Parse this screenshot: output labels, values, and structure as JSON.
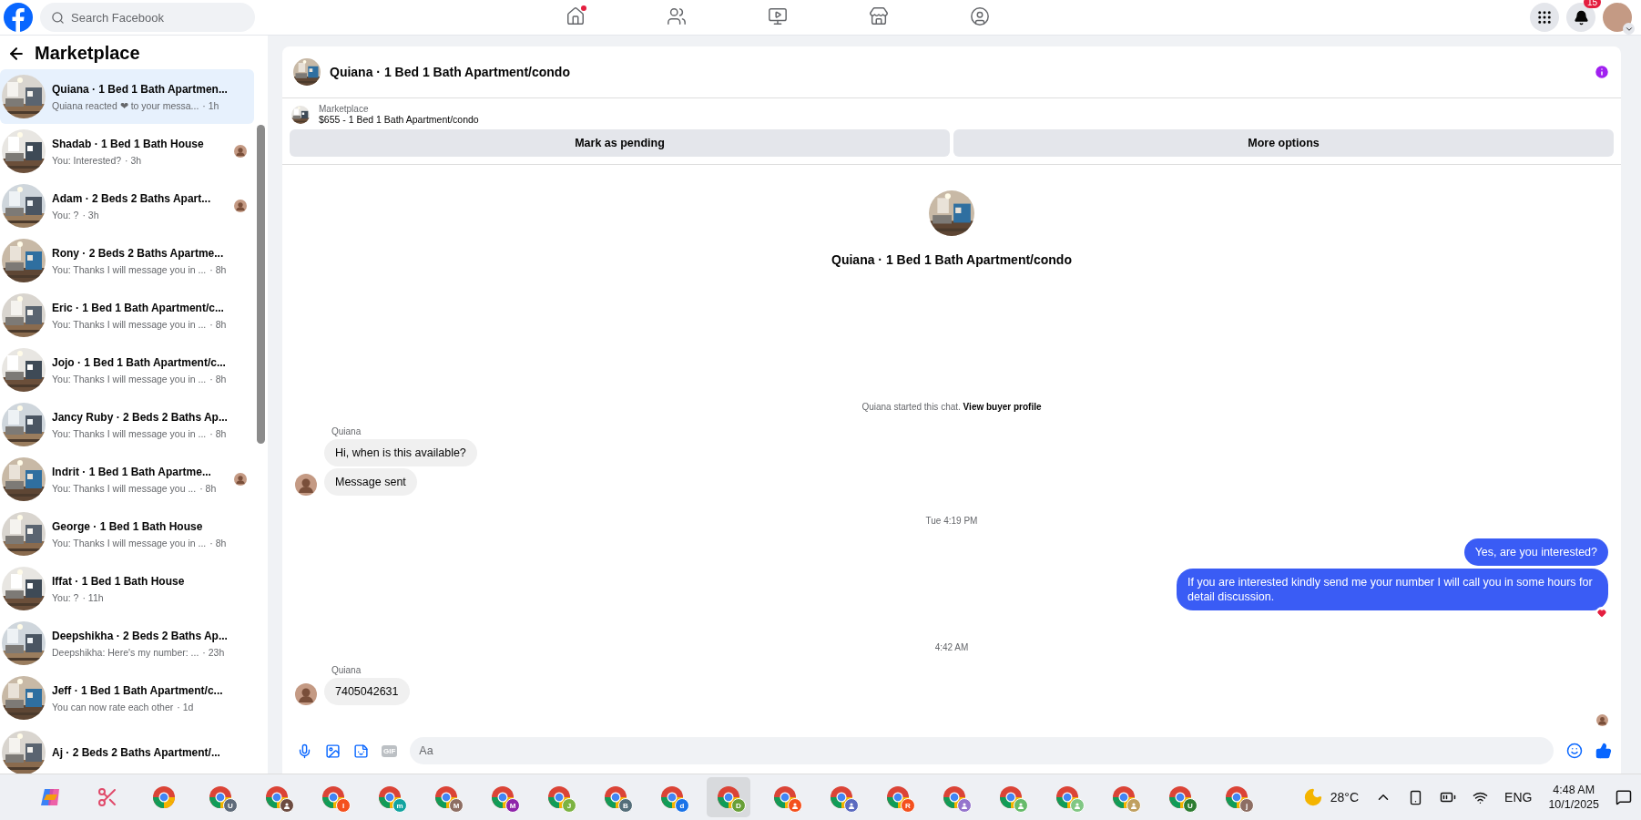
{
  "topbar": {
    "search": {
      "placeholder": "Search Facebook"
    },
    "nav": [
      {
        "kind": "home",
        "selected": false,
        "dot": true
      },
      {
        "kind": "friends",
        "selected": false,
        "dot": false
      },
      {
        "kind": "video",
        "selected": false,
        "dot": false
      },
      {
        "kind": "marketplace",
        "selected": false,
        "dot": false
      },
      {
        "kind": "groups",
        "selected": false,
        "dot": false
      }
    ],
    "notifications_badge": "15"
  },
  "sidebar": {
    "title": "Marketplace",
    "conversations": [
      {
        "title": "Quiana · 1 Bed 1 Bath Apartmen...",
        "preview": "Quiana reacted ❤ to your messa...",
        "time": "· 1h",
        "selected": true,
        "seen": false
      },
      {
        "title": "Shadab · 1 Bed 1 Bath House",
        "preview": "You: Interested?",
        "time": "· 3h",
        "selected": false,
        "seen": true
      },
      {
        "title": "Adam · 2 Beds 2 Baths Apart...",
        "preview": "You: ?",
        "time": "· 3h",
        "selected": false,
        "seen": true
      },
      {
        "title": "Rony · 2 Beds 2 Baths Apartme...",
        "preview": "You: Thanks I will message you in ...",
        "time": "· 8h",
        "selected": false,
        "seen": false
      },
      {
        "title": "Eric · 1 Bed 1 Bath Apartment/c...",
        "preview": "You: Thanks I will message you in ...",
        "time": "· 8h",
        "selected": false,
        "seen": false
      },
      {
        "title": "Jojo · 1 Bed 1 Bath Apartment/c...",
        "preview": "You: Thanks I will message you in ...",
        "time": "· 8h",
        "selected": false,
        "seen": false
      },
      {
        "title": "Jancy Ruby · 2 Beds 2 Baths Ap...",
        "preview": "You: Thanks I will message you in ...",
        "time": "· 8h",
        "selected": false,
        "seen": false
      },
      {
        "title": "Indrit · 1 Bed 1 Bath Apartme...",
        "preview": "You: Thanks I will message you ...",
        "time": "· 8h",
        "selected": false,
        "seen": true
      },
      {
        "title": "George · 1 Bed 1 Bath House",
        "preview": "You: Thanks I will message you in ...",
        "time": "· 8h",
        "selected": false,
        "seen": false
      },
      {
        "title": "Iffat · 1 Bed 1 Bath House",
        "preview": "You: ?",
        "time": "· 11h",
        "selected": false,
        "seen": false
      },
      {
        "title": "Deepshikha · 2 Beds 2 Baths Ap...",
        "preview": "Deepshikha: Here's my number: ...",
        "time": "· 23h",
        "selected": false,
        "seen": false
      },
      {
        "title": "Jeff · 1 Bed 1 Bath Apartment/c...",
        "preview": "You can now rate each other",
        "time": "· 1d",
        "selected": false,
        "seen": false
      },
      {
        "title": "Aj · 2 Beds 2 Baths Apartment/...",
        "selected": false,
        "seen": false
      }
    ]
  },
  "chat": {
    "title": "Quiana · 1 Bed 1 Bath Apartment/condo",
    "listing": {
      "label": "Marketplace",
      "text": "$655 - 1 Bed 1 Bath Apartment/condo"
    },
    "buttons": [
      "Mark as pending",
      "More options"
    ],
    "intro_title": "Quiana · 1 Bed 1 Bath Apartment/condo",
    "messages": [
      {
        "kind": "system",
        "text": "Quiana started this chat.",
        "link": "View buyer profile"
      },
      {
        "kind": "sender",
        "text": "Quiana"
      },
      {
        "kind": "incoming",
        "text": "Hi, when is this available?",
        "avatar": false
      },
      {
        "kind": "incoming",
        "text": "Message sent",
        "avatar": true
      },
      {
        "kind": "timestamp",
        "text": "Tue 4:19 PM"
      },
      {
        "kind": "outgoing",
        "text": "Yes, are you interested?",
        "reacted": false
      },
      {
        "kind": "outgoing",
        "text": "If you are interested kindly send me your number I will call you in some hours for detail discussion.",
        "reacted": true
      },
      {
        "kind": "timestamp",
        "text": "4:42 AM"
      },
      {
        "kind": "sender",
        "text": "Quiana"
      },
      {
        "kind": "incoming",
        "text": "7405042631",
        "avatar": true
      }
    ],
    "seen": true,
    "composer": {
      "gif": "GIF",
      "placeholder": "Aa"
    }
  },
  "taskbar": {
    "items": [
      {
        "kind": "copilot",
        "selected": false
      },
      {
        "kind": "snipping",
        "selected": false
      },
      {
        "kind": "chrome",
        "selected": false
      },
      {
        "kind": "chrome",
        "badge": "U",
        "color": "#5f6b7a",
        "selected": false
      },
      {
        "kind": "chrome",
        "color": "#6d4c41",
        "selected": false
      },
      {
        "kind": "chrome",
        "badge": "I",
        "color": "#f4511e",
        "selected": false
      },
      {
        "kind": "chrome",
        "badge": "m",
        "color": "#12a4a0",
        "selected": false
      },
      {
        "kind": "chrome",
        "badge": "M",
        "color": "#8d6e63",
        "selected": false
      },
      {
        "kind": "chrome",
        "badge": "M",
        "color": "#8e24aa",
        "selected": false
      },
      {
        "kind": "chrome",
        "badge": "J",
        "color": "#7cb342",
        "selected": false
      },
      {
        "kind": "chrome",
        "badge": "B",
        "color": "#546e7a",
        "selected": false
      },
      {
        "kind": "chrome",
        "badge": "d",
        "color": "#1a73e8",
        "selected": false
      },
      {
        "kind": "chrome",
        "badge": "D",
        "color": "#689f38",
        "selected": true
      },
      {
        "kind": "chrome",
        "color": "#f4511e",
        "selected": false
      },
      {
        "kind": "chrome",
        "color": "#5c6bc0",
        "selected": false
      },
      {
        "kind": "chrome",
        "badge": "R",
        "color": "#f4511e",
        "selected": false
      },
      {
        "kind": "chrome",
        "color": "#9575cd",
        "selected": false
      },
      {
        "kind": "chrome",
        "color": "#66bb6a",
        "selected": false
      },
      {
        "kind": "chrome",
        "color": "#81c784",
        "selected": false
      },
      {
        "kind": "chrome",
        "color": "#c0a060",
        "selected": false
      },
      {
        "kind": "chrome",
        "badge": "U",
        "color": "#2e7d32",
        "selected": false
      },
      {
        "kind": "chrome",
        "badge": "j",
        "color": "#8d6e63",
        "selected": false
      }
    ],
    "weather": "28°C",
    "language": "ENG",
    "time": "4:48 AM",
    "date": "10/1/2025"
  }
}
